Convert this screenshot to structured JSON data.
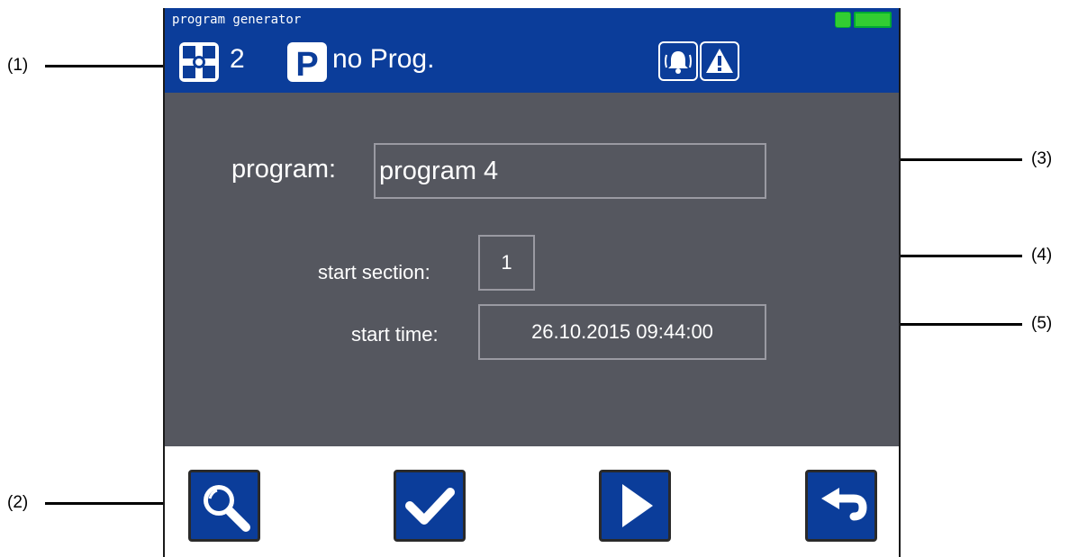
{
  "callouts": {
    "c1": "(1)",
    "c2": "(2)",
    "c3": "(3)",
    "c4": "(4)",
    "c5": "(5)"
  },
  "window": {
    "title": "program generator"
  },
  "header": {
    "device_number": "2",
    "program_status": "no Prog."
  },
  "form": {
    "program_label": "program:",
    "program_value": "program 4",
    "start_section_label": "start section:",
    "start_section_value": "1",
    "start_time_label": "start time:",
    "start_time_value": "26.10.2015 09:44:00"
  },
  "toolbar": {
    "buttons": [
      "search",
      "confirm",
      "start",
      "back"
    ]
  },
  "colors": {
    "bar_blue": "#0b3d9a",
    "content_gray": "#55575f",
    "status_green": "#32cd32"
  }
}
